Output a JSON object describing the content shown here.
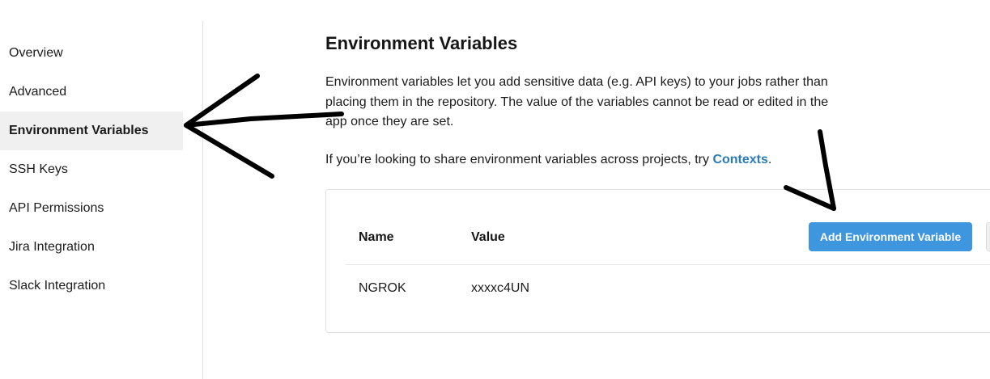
{
  "sidebar": {
    "items": [
      {
        "label": "Overview",
        "active": false
      },
      {
        "label": "Advanced",
        "active": false
      },
      {
        "label": "Environment Variables",
        "active": true
      },
      {
        "label": "SSH Keys",
        "active": false
      },
      {
        "label": "API Permissions",
        "active": false
      },
      {
        "label": "Jira Integration",
        "active": false
      },
      {
        "label": "Slack Integration",
        "active": false
      }
    ]
  },
  "main": {
    "title": "Environment Variables",
    "description": "Environment variables let you add sensitive data (e.g. API keys) to your jobs rather than placing them in the repository. The value of the variables cannot be read or edited in the app once they are set.",
    "contexts_prefix": "If you’re looking to share environment variables across projects, try ",
    "contexts_link": "Contexts",
    "contexts_suffix": "."
  },
  "table": {
    "columns": [
      "Name",
      "Value"
    ],
    "add_button_label": "Add Environment Variable",
    "rows": [
      {
        "name": "NGROK",
        "value": "xxxxc4UN"
      }
    ]
  },
  "colors": {
    "accent": "#3e96de",
    "link": "#2b7bb9",
    "active_nav_bg": "#f0f0f0",
    "annotation": "#000000"
  }
}
